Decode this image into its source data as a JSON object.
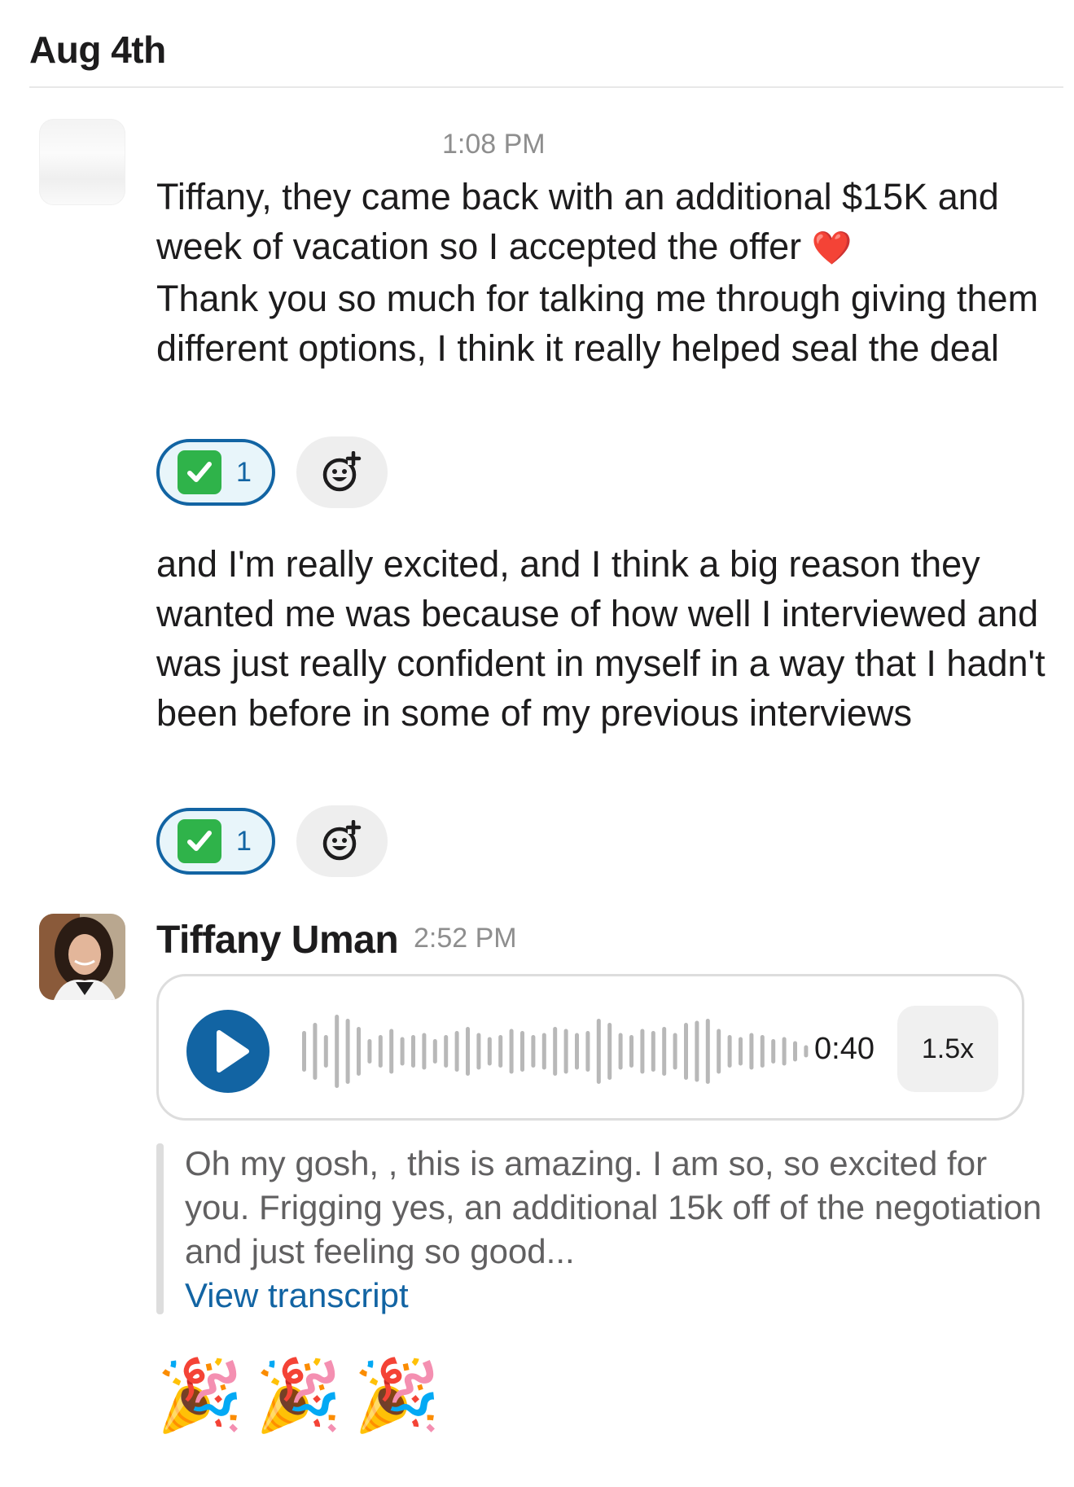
{
  "date_header": "Aug 4th",
  "message_group_1": {
    "timestamp": "1:08 PM",
    "message_1": "Tiffany, they came back with an additional $15K and week of vacation so I accepted the offer",
    "heart_emoji": "❤️",
    "message_1_cont": "Thank you so much for talking me through giving them different options, I think it really helped seal the deal",
    "reaction_1": {
      "emoji": "white-check-mark",
      "count": "1"
    },
    "message_2": "and I'm really excited, and I think a big reason they wanted me was because of how well I interviewed and was just really confident in myself in a way that I hadn't been before in some of my previous interviews",
    "reaction_2": {
      "emoji": "white-check-mark",
      "count": "1"
    }
  },
  "message_group_2": {
    "sender": "Tiffany Uman",
    "timestamp": "2:52 PM",
    "audio": {
      "duration": "0:40",
      "speed": "1.5x"
    },
    "transcript": {
      "text": "Oh my gosh, , this is amazing. I am so, so excited for you. Frigging yes, an additional 15k off of the negotiation and just feeling so good...",
      "link": "View transcript"
    },
    "celebration": [
      "🎉",
      "🎉",
      "🎉"
    ]
  },
  "colors": {
    "accent": "#1264a3",
    "check_green": "#2fb34a",
    "muted": "#8e8e8e"
  }
}
